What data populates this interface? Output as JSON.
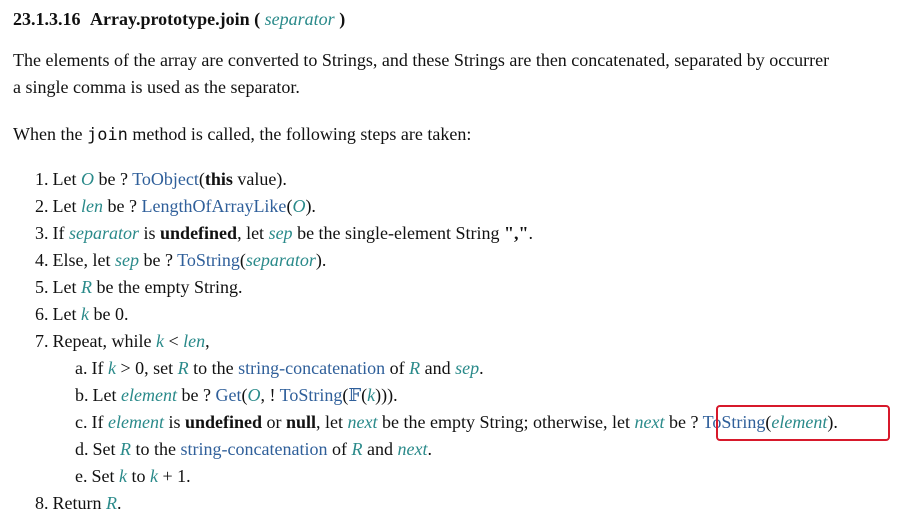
{
  "heading": {
    "section_number": "23.1.3.16",
    "title": "Array.prototype.join",
    "open_paren": "(",
    "param": "separator",
    "close_paren": ")"
  },
  "intro": {
    "line1": "The elements of the array are converted to Strings, and these Strings are then concatenated, separated by occurrer",
    "line2": "a single comma is used as the separator."
  },
  "when": {
    "before": "When the ",
    "code": "join",
    "after": " method is called, the following steps are taken:"
  },
  "steps": {
    "s1": {
      "num": "1.",
      "t1": "Let ",
      "O": "O",
      "t2": " be ? ",
      "ToObject": "ToObject",
      "t3": "(",
      "this": "this",
      "t4": " value)."
    },
    "s2": {
      "num": "2.",
      "t1": "Let ",
      "len": "len",
      "t2": " be ? ",
      "op": "LengthOfArrayLike",
      "t3": "(",
      "O": "O",
      "t4": ")."
    },
    "s3": {
      "num": "3.",
      "t1": "If ",
      "separator": "separator",
      "t2": " is ",
      "undefined": "undefined",
      "t3": ", let ",
      "sep": "sep",
      "t4": " be the single-element String ",
      "comma": "\",\"",
      "t5": "."
    },
    "s4": {
      "num": "4.",
      "t1": "Else, let ",
      "sep": "sep",
      "t2": " be ? ",
      "ToString": "ToString",
      "t3": "(",
      "separator": "separator",
      "t4": ")."
    },
    "s5": {
      "num": "5.",
      "t1": "Let ",
      "R": "R",
      "t2": " be the empty String."
    },
    "s6": {
      "num": "6.",
      "t1": "Let ",
      "k": "k",
      "t2": " be 0."
    },
    "s7": {
      "num": "7.",
      "t1": "Repeat, while ",
      "k": "k",
      "t2": " < ",
      "len": "len",
      "t3": ","
    },
    "s7a": {
      "num": "a.",
      "t1": "If ",
      "k": "k",
      "t2": " > 0, set ",
      "R": "R",
      "t3": " to the ",
      "strcat": "string-concatenation",
      "t4": " of ",
      "R2": "R",
      "t5": " and ",
      "sep": "sep",
      "t6": "."
    },
    "s7b": {
      "num": "b.",
      "t1": "Let ",
      "element": "element",
      "t2": " be ? ",
      "Get": "Get",
      "t3": "(",
      "O": "O",
      "t4": ", ! ",
      "ToString": "ToString",
      "t5": "(",
      "F": "𝔽",
      "t6": "(",
      "k": "k",
      "t7": ")))."
    },
    "s7c": {
      "num": "c.",
      "t1": "If ",
      "element": "element",
      "t2": " is ",
      "undefined": "undefined",
      "t3": " or ",
      "null": "null",
      "t4": ", let ",
      "next": "next",
      "t5": " be the empty String; otherwise, let ",
      "next2": "next",
      "t6": " be ? ",
      "ToString": "ToString",
      "t7": "(",
      "element2": "element",
      "t8": ")."
    },
    "s7d": {
      "num": "d.",
      "t1": "Set ",
      "R": "R",
      "t2": " to the ",
      "strcat": "string-concatenation",
      "t3": " of ",
      "R2": "R",
      "t4": " and ",
      "next": "next",
      "t5": "."
    },
    "s7e": {
      "num": "e.",
      "t1": "Set ",
      "k": "k",
      "t2": " to ",
      "k2": "k",
      "t3": " + 1."
    },
    "s8": {
      "num": "8.",
      "t1": "Return ",
      "R": "R",
      "t2": "."
    }
  },
  "colors": {
    "variable": "#2a8a8a",
    "link": "#2f5f9a",
    "highlight_box": "#d7192b"
  }
}
